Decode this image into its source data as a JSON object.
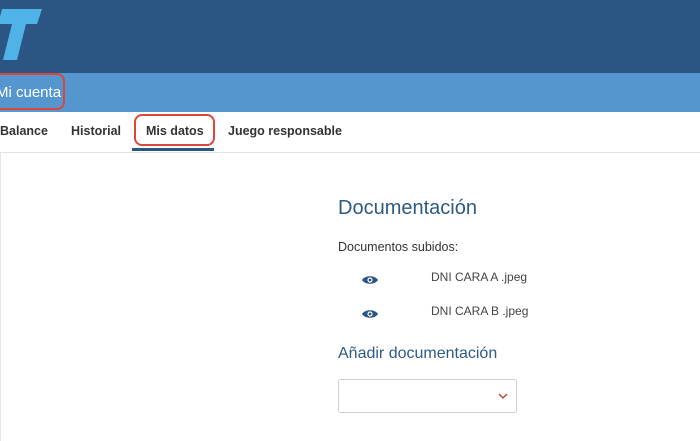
{
  "header": {
    "logo": "brand-logo",
    "account_title": "Mi cuenta"
  },
  "tabs": [
    {
      "label": "Balance"
    },
    {
      "label": "Historial"
    },
    {
      "label": "Mis datos",
      "active": true
    },
    {
      "label": "Juego responsable"
    }
  ],
  "documentation": {
    "title": "Documentación",
    "uploaded_label": "Documentos subidos:",
    "files": [
      {
        "name": "DNI CARA A .jpeg",
        "icon": "eye-icon"
      },
      {
        "name": "DNI CARA B .jpeg",
        "icon": "eye-icon"
      }
    ],
    "add_title": "Añadir documentación",
    "select": {
      "value": "",
      "icon": "chevron-down-icon"
    }
  },
  "colors": {
    "topbar": "#2b5582",
    "subbar": "#5596cf",
    "heading": "#2e5a86",
    "highlight": "#d9483b",
    "chevron": "#c0392b"
  }
}
